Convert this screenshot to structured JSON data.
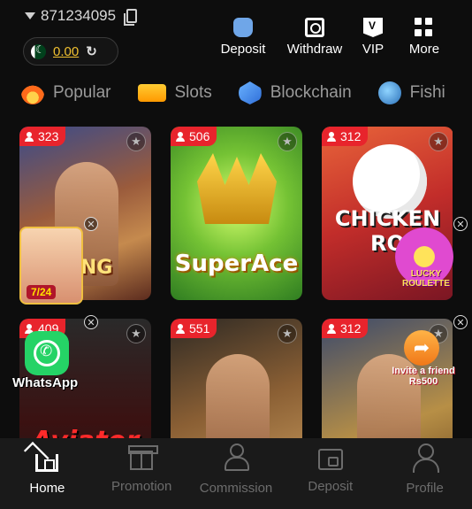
{
  "account": {
    "number": "871234095"
  },
  "balance": {
    "value": "0.00"
  },
  "actions": [
    {
      "label": "Deposit",
      "icon": "wallet-bag-icon"
    },
    {
      "label": "Withdraw",
      "icon": "withdraw-icon"
    },
    {
      "label": "VIP",
      "icon": "vip-icon"
    },
    {
      "label": "More",
      "icon": "grid-icon"
    }
  ],
  "tabs": [
    {
      "label": "Popular",
      "icon": "fire-icon"
    },
    {
      "label": "Slots",
      "icon": "slots-777-icon"
    },
    {
      "label": "Blockchain",
      "icon": "blockchain-icon"
    },
    {
      "label": "Fishi",
      "icon": "fish-icon"
    }
  ],
  "games": [
    {
      "players": "323",
      "title": "KING"
    },
    {
      "players": "506",
      "title": "SuperAce"
    },
    {
      "players": "312",
      "title": "CHICKEN RO"
    },
    {
      "players": "409",
      "title": "Aviator"
    },
    {
      "players": "551",
      "title": ""
    },
    {
      "players": "312",
      "title": ""
    }
  ],
  "overlays": {
    "promo_badge": "7/24",
    "whatsapp_label": "WhatsApp",
    "roulette_label": "LUCKY ROULETTE",
    "invite_label": "Invite a friend Rs500"
  },
  "bottom_nav": [
    {
      "label": "Home",
      "active": true
    },
    {
      "label": "Promotion",
      "active": false
    },
    {
      "label": "Commission",
      "active": false
    },
    {
      "label": "Deposit",
      "active": false
    },
    {
      "label": "Profile",
      "active": false
    }
  ],
  "colors": {
    "background": "#0d0d0d",
    "badge_red": "#e8242c",
    "balance_gold": "#f0c030",
    "nav_inactive": "#6c6c6c"
  }
}
